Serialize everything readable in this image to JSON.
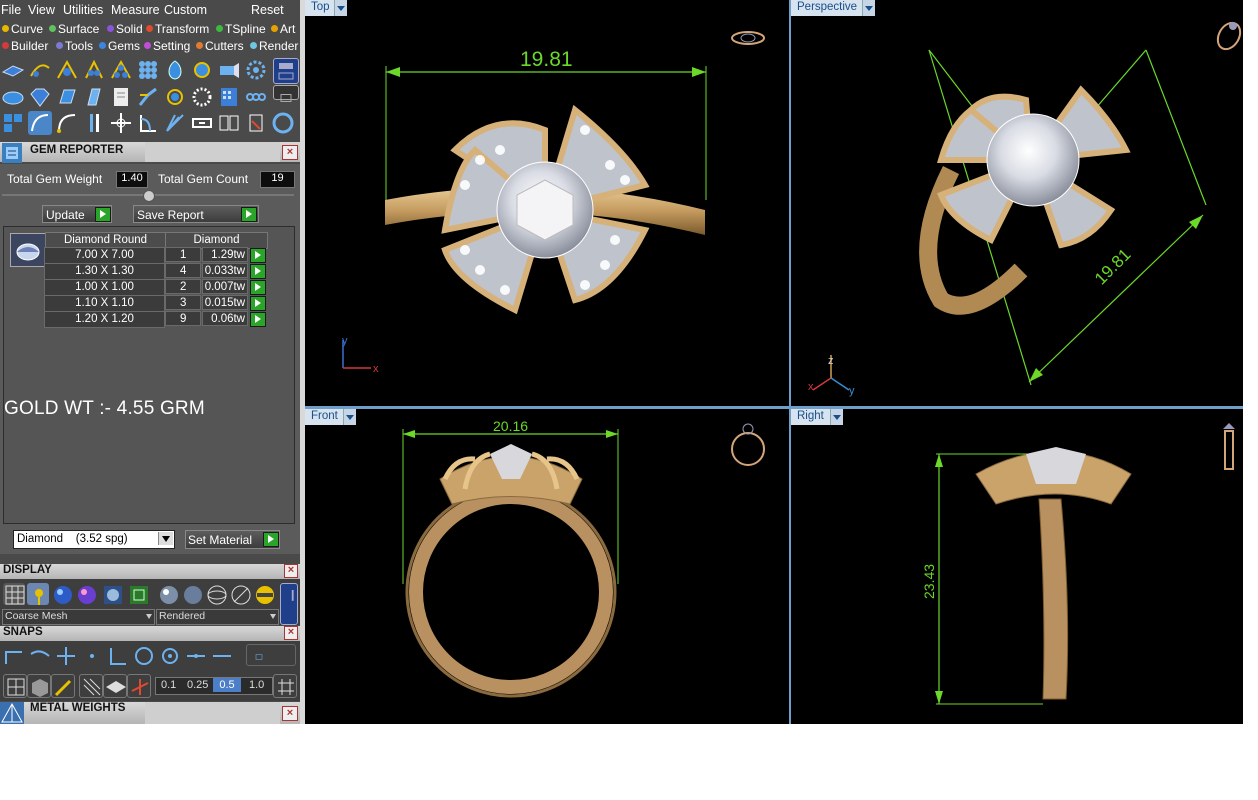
{
  "menu": {
    "items": [
      "File",
      "View",
      "Utilities",
      "Measure",
      "Custom"
    ],
    "reset": "Reset"
  },
  "groups": {
    "row1": [
      {
        "label": "Curve",
        "color": "#e6b800"
      },
      {
        "label": "Surface",
        "color": "#5fc15f"
      },
      {
        "label": "Solid",
        "color": "#8a55d6"
      },
      {
        "label": "Transform",
        "color": "#e04b2f"
      },
      {
        "label": "TSpline",
        "color": "#3dba3d"
      },
      {
        "label": "Art",
        "color": "#e6a300"
      }
    ],
    "row2": [
      {
        "label": "Builder",
        "color": "#d63a3a"
      },
      {
        "label": "Tools",
        "color": "#7a7ad6"
      },
      {
        "label": "Gems",
        "color": "#3b86e0"
      },
      {
        "label": "Setting",
        "color": "#c04fd6"
      },
      {
        "label": "Cutters",
        "color": "#e07b2f"
      },
      {
        "label": "Render",
        "color": "#6fc6e0"
      }
    ]
  },
  "gem_reporter": {
    "title": "GEM REPORTER",
    "total_weight_label": "Total Gem Weight",
    "total_weight_value": "1.40",
    "total_count_label": "Total Gem Count",
    "total_count_value": "19",
    "update_label": "Update",
    "save_report_label": "Save Report",
    "table": {
      "col1": "Diamond Round",
      "col2": "Diamond",
      "rows": [
        {
          "size": "7.00 X 7.00",
          "qty": "1",
          "weight": "1.29tw"
        },
        {
          "size": "1.30 X 1.30",
          "qty": "4",
          "weight": "0.033tw"
        },
        {
          "size": "1.00 X 1.00",
          "qty": "2",
          "weight": "0.007tw"
        },
        {
          "size": "1.10 X 1.10",
          "qty": "3",
          "weight": "0.015tw"
        },
        {
          "size": "1.20 X 1.20",
          "qty": "9",
          "weight": "0.06tw"
        }
      ]
    },
    "note": "GOLD WT :- 4.55 GRM",
    "material_select": "Diamond    (3.52 spg)",
    "set_material_label": "Set Material"
  },
  "display": {
    "title": "DISPLAY",
    "mesh_select": "Coarse Mesh",
    "render_select": "Rendered"
  },
  "snaps": {
    "title": "SNAPS",
    "values": [
      "0.1",
      "0.25",
      "0.5",
      "1.0"
    ],
    "active_value": "0.5"
  },
  "metal_weights": {
    "title": "METAL WEIGHTS"
  },
  "viewports": {
    "top": {
      "label": "Top",
      "dimension": "19.81",
      "axis_y": "y",
      "axis_x": "x"
    },
    "perspective": {
      "label": "Perspective",
      "dimension": "19.81",
      "axis_z": "z",
      "axis_x": "x",
      "axis_y": "y"
    },
    "front": {
      "label": "Front",
      "dimension": "20.16"
    },
    "right": {
      "label": "Right",
      "dimension": "23.43"
    }
  },
  "colors": {
    "dimension_green": "#6bd82a",
    "gold_metal": "#c9a36a",
    "viewport_bg": "#000000",
    "panel_bg": "#4a4a4a",
    "accent_button": "#2aa52a"
  }
}
